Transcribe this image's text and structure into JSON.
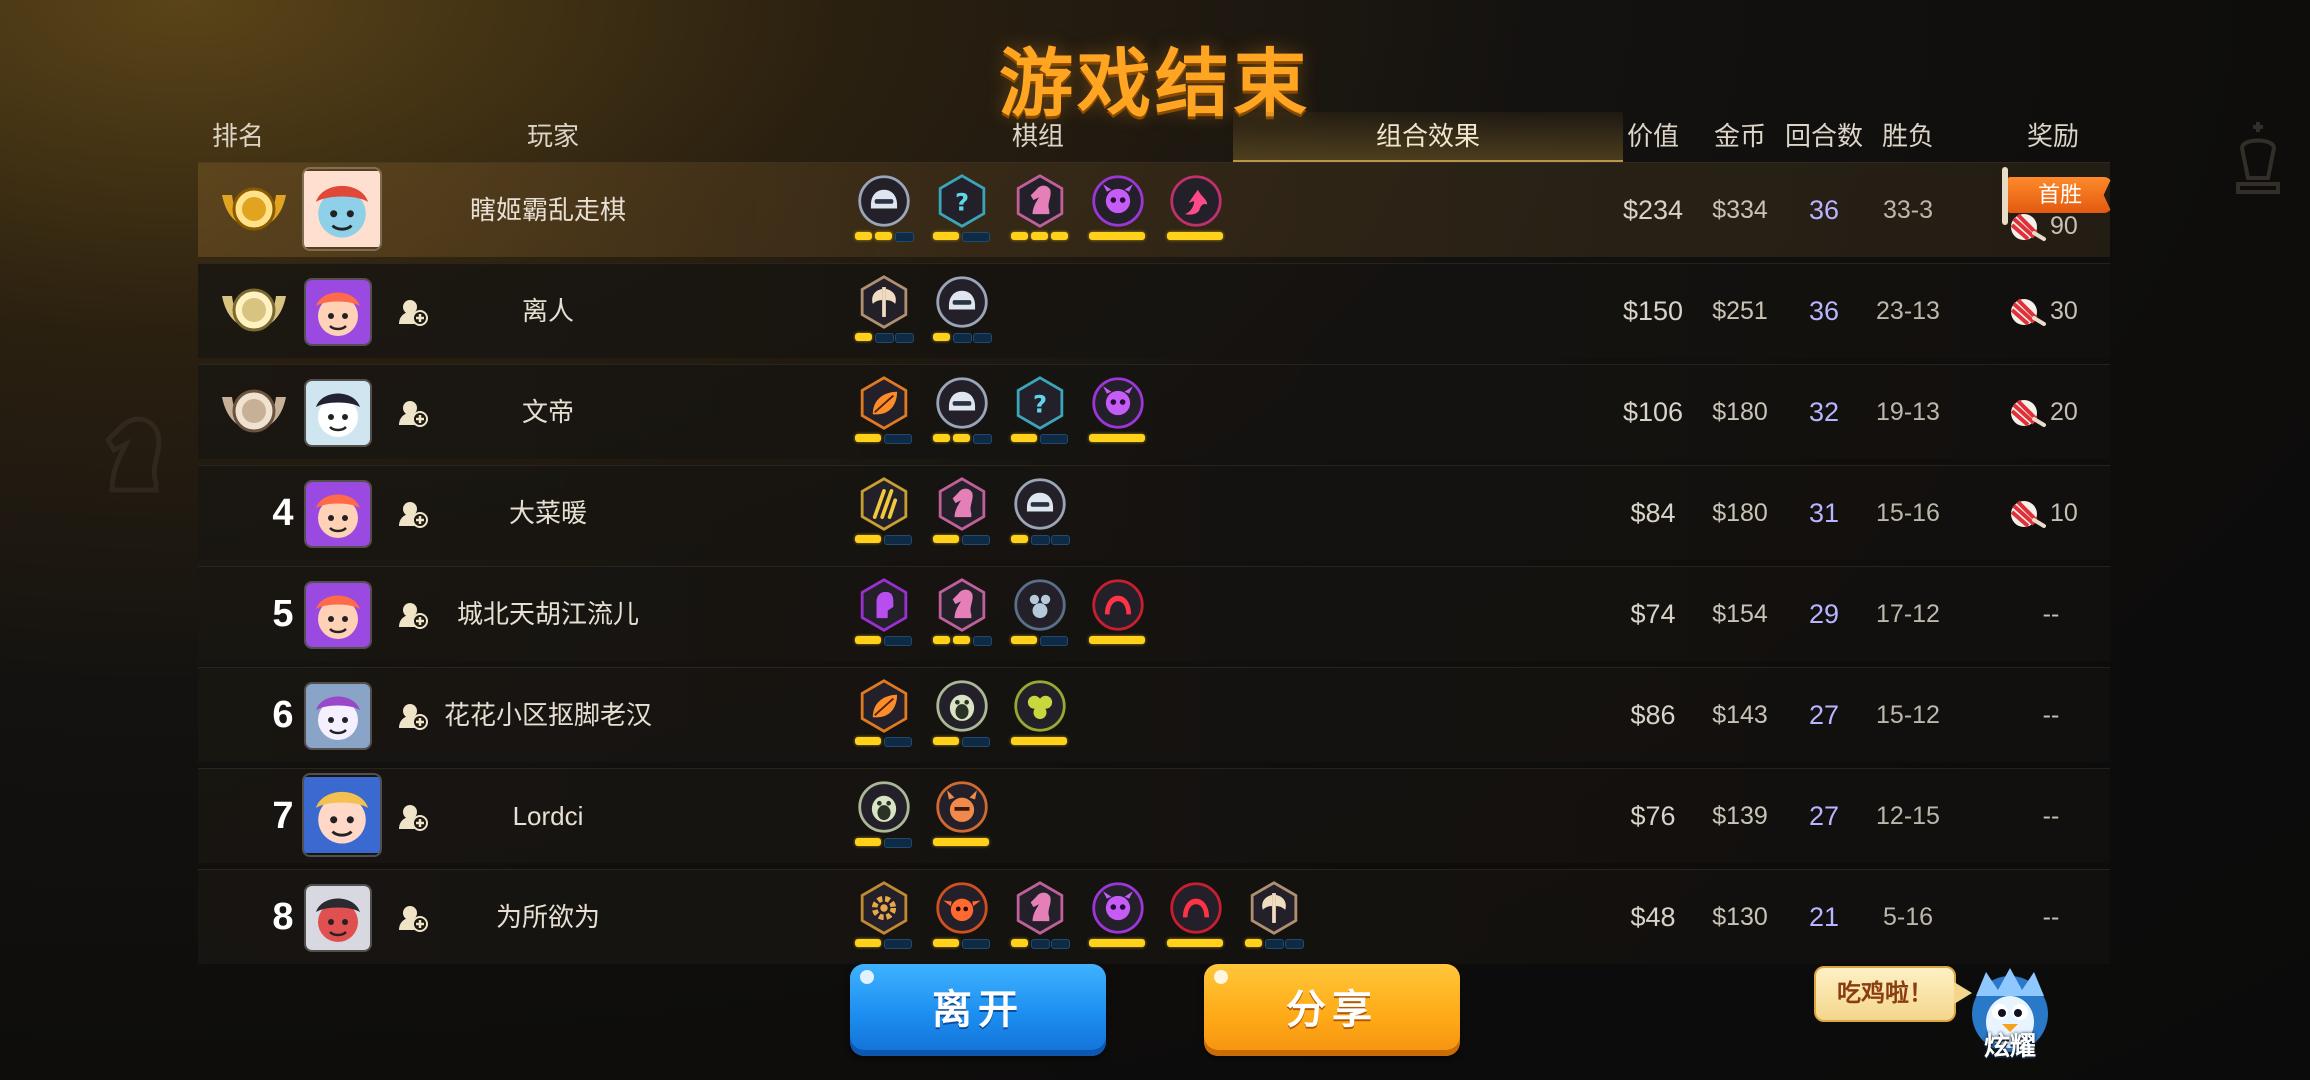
{
  "title": "游戏结束",
  "headers": {
    "rank": "排名",
    "player": "玩家",
    "pieces": "棋组",
    "synergy": "组合效果",
    "value": "价值",
    "gold": "金币",
    "rounds": "回合数",
    "winloss": "胜负",
    "reward": "奖励"
  },
  "colors": {
    "title": "#ffa522",
    "rounds_text": "#b8b4ff",
    "pip_on": "#ffd11a",
    "pip_off": "#0e2a44",
    "leave_button": "#1c8ef0",
    "share_button": "#ffab18",
    "first_win_ribbon": "#ff8a2a"
  },
  "rows": [
    {
      "rank": "1",
      "rank_display": "gold-medal",
      "name": "瞎姬霸乱走棋",
      "avatar": "red-monster-avatar",
      "value": "$234",
      "gold": "$334",
      "rounds": "36",
      "winloss": "33-3",
      "first_win": "首胜",
      "reward": "90",
      "synergies": [
        {
          "icon": "knight-helmet-icon",
          "pips": [
            1,
            1,
            0
          ]
        },
        {
          "icon": "mystery-icon",
          "pips": [
            1,
            0
          ]
        },
        {
          "icon": "horse-icon",
          "pips": [
            1,
            1,
            1
          ]
        },
        {
          "icon": "demon-skull-icon",
          "pips": [
            1
          ]
        },
        {
          "icon": "dragon-icon",
          "pips": [
            1
          ]
        }
      ]
    },
    {
      "rank": "2",
      "rank_display": "silver-medal",
      "name": "离人",
      "avatar": "pink-brawler-avatar",
      "value": "$150",
      "gold": "$251",
      "rounds": "36",
      "winloss": "23-13",
      "reward": "30",
      "synergies": [
        {
          "icon": "axe-warrior-icon",
          "pips": [
            1,
            0,
            0
          ]
        },
        {
          "icon": "knight-helmet-icon",
          "pips": [
            1,
            0,
            0
          ]
        }
      ]
    },
    {
      "rank": "3",
      "rank_display": "bronze-medal",
      "name": "文帝",
      "avatar": "robot-face-avatar",
      "value": "$106",
      "gold": "$180",
      "rounds": "32",
      "winloss": "19-13",
      "reward": "20",
      "synergies": [
        {
          "icon": "leaf-icon",
          "pips": [
            1,
            0
          ]
        },
        {
          "icon": "knight-helmet-icon",
          "pips": [
            1,
            1,
            0
          ]
        },
        {
          "icon": "mystery-icon",
          "pips": [
            1,
            0
          ]
        },
        {
          "icon": "demon-skull-icon",
          "pips": [
            1
          ]
        }
      ]
    },
    {
      "rank": "4",
      "name": "大菜暖",
      "avatar": "pink-brawler-avatar",
      "value": "$84",
      "gold": "$180",
      "rounds": "31",
      "winloss": "15-16",
      "reward": "10",
      "synergies": [
        {
          "icon": "claws-icon",
          "pips": [
            1,
            0
          ]
        },
        {
          "icon": "horse-icon",
          "pips": [
            1,
            0
          ]
        },
        {
          "icon": "knight-helmet-icon",
          "pips": [
            1,
            0,
            0
          ]
        }
      ]
    },
    {
      "rank": "5",
      "name": "城北天胡江流儿",
      "avatar": "pink-brawler-avatar",
      "value": "$74",
      "gold": "$154",
      "rounds": "29",
      "winloss": "17-12",
      "reward": "--",
      "synergies": [
        {
          "icon": "fist-icon",
          "pips": [
            1,
            0
          ]
        },
        {
          "icon": "horse-icon",
          "pips": [
            1,
            1,
            0
          ]
        },
        {
          "icon": "paw-icon",
          "pips": [
            1,
            0
          ]
        },
        {
          "icon": "shield-arc-icon",
          "pips": [
            1
          ]
        }
      ]
    },
    {
      "rank": "6",
      "name": "花花小区抠脚老汉",
      "avatar": "purple-bird-avatar",
      "value": "$86",
      "gold": "$143",
      "rounds": "27",
      "winloss": "15-12",
      "reward": "--",
      "synergies": [
        {
          "icon": "leaf-icon",
          "pips": [
            1,
            0
          ]
        },
        {
          "icon": "penguin-icon",
          "pips": [
            1,
            0
          ]
        },
        {
          "icon": "cluster-icon",
          "pips": [
            1
          ]
        }
      ]
    },
    {
      "rank": "7",
      "name": "Lordci",
      "avatar": "blonde-girl-avatar",
      "value": "$76",
      "gold": "$139",
      "rounds": "27",
      "winloss": "12-15",
      "reward": "--",
      "synergies": [
        {
          "icon": "penguin-icon",
          "pips": [
            1,
            0
          ]
        },
        {
          "icon": "viking-icon",
          "pips": [
            1
          ]
        }
      ]
    },
    {
      "rank": "8",
      "name": "为所欲为",
      "avatar": "ninja-avatar",
      "value": "$48",
      "gold": "$130",
      "rounds": "21",
      "winloss": "5-16",
      "reward": "--",
      "synergies": [
        {
          "icon": "gear-icon",
          "pips": [
            1,
            0
          ]
        },
        {
          "icon": "goblin-icon",
          "pips": [
            1,
            0
          ]
        },
        {
          "icon": "horse-icon",
          "pips": [
            1,
            0,
            0
          ]
        },
        {
          "icon": "demon-skull-icon",
          "pips": [
            1
          ]
        },
        {
          "icon": "shield-arc-icon",
          "pips": [
            1
          ]
        },
        {
          "icon": "axe-warrior-icon",
          "pips": [
            1,
            0,
            0
          ]
        }
      ]
    }
  ],
  "buttons": {
    "leave": "离开",
    "share": "分享"
  },
  "bubble": "吃鸡啦！",
  "mascot_label": "炫耀"
}
